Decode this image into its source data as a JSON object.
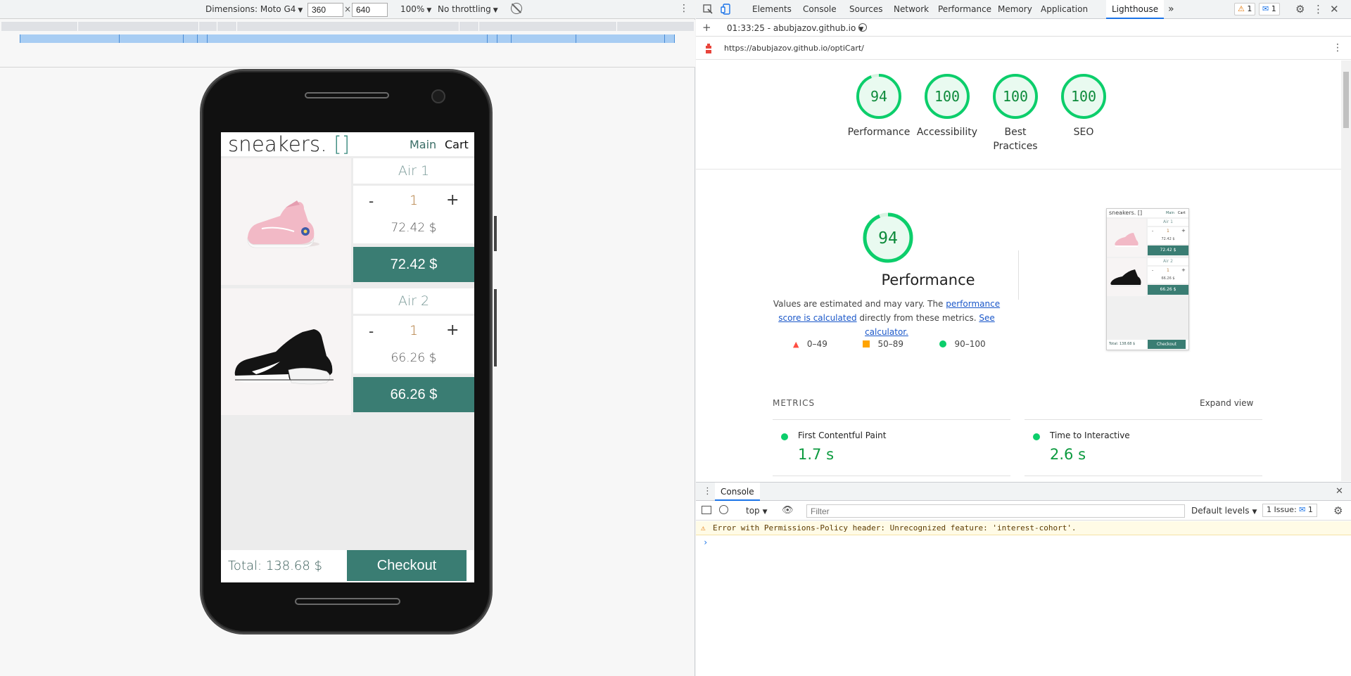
{
  "device_toolbar": {
    "dimensions_label": "Dimensions: Moto G4",
    "width_value": "360",
    "height_value": "640",
    "times": "×",
    "zoom": "100%",
    "throttle": "No throttling"
  },
  "app": {
    "logo": "sneakers.",
    "logo_brackets": "[]",
    "nav_main": "Main",
    "nav_cart": "Cart",
    "items": [
      {
        "name": "Air 1",
        "minus": "-",
        "qty": "1",
        "plus": "+",
        "unit_price": "72.42 $",
        "total": "72.42 $"
      },
      {
        "name": "Air 2",
        "minus": "-",
        "qty": "1",
        "plus": "+",
        "unit_price": "66.26 $",
        "total": "66.26 $"
      }
    ],
    "total": "Total: 138.68 $",
    "checkout": "Checkout"
  },
  "devtools": {
    "tabs": [
      "Elements",
      "Console",
      "Sources",
      "Network",
      "Performance",
      "Memory",
      "Application",
      "Lighthouse"
    ],
    "active_tab": "Lighthouse",
    "more_tabs": "»",
    "warning_count": "1",
    "message_count": "1",
    "lh_toolbar": {
      "add": "+",
      "report": "01:33:25 - abubjazov.github.io"
    },
    "url": "https://abubjazov.github.io/optiCart/",
    "scores": [
      {
        "score": "94",
        "label": "Performance",
        "value": 94
      },
      {
        "score": "100",
        "label": "Accessibility",
        "value": 100
      },
      {
        "score": "100",
        "label": "Best Practices",
        "value": 100
      },
      {
        "score": "100",
        "label": "SEO",
        "value": 100
      }
    ],
    "perf": {
      "score": "94",
      "title": "Performance",
      "desc_1": "Values are estimated and may vary. The ",
      "desc_link1": "performance score is calculated",
      "desc_2": " directly from these metrics. ",
      "desc_link2": "See calculator.",
      "legend": [
        "0–49",
        "50–89",
        "90–100"
      ]
    },
    "thumb": {
      "logo": "sneakers. []",
      "main": "Main",
      "cart": "Cart",
      "items": [
        {
          "name": "Air 1",
          "unit": "72.42 $",
          "total": "72.42 $"
        },
        {
          "name": "Air 2",
          "unit": "66.26 $",
          "total": "66.26 $"
        }
      ],
      "minus": "-",
      "qty": "1",
      "plus": "+",
      "total": "Total: 138.68 $",
      "checkout": "Checkout"
    },
    "metrics_label": "METRICS",
    "expand_view": "Expand view",
    "metrics": [
      {
        "name": "First Contentful Paint",
        "value": "1.7 s"
      },
      {
        "name": "Time to Interactive",
        "value": "2.6 s"
      }
    ],
    "console": {
      "tab": "Console",
      "context": "top",
      "filter_placeholder": "Filter",
      "levels": "Default levels",
      "issues": "1 Issue:",
      "issues_count": "1",
      "warning": "Error with Permissions-Policy header: Unrecognized feature: 'interest-cohort'.",
      "prompt": "›"
    }
  },
  "colors": {
    "accent": "#3a7d73",
    "pass": "#0cce6b",
    "average": "#ffa400",
    "fail": "#ff4e42",
    "link": "#1a57c9"
  }
}
